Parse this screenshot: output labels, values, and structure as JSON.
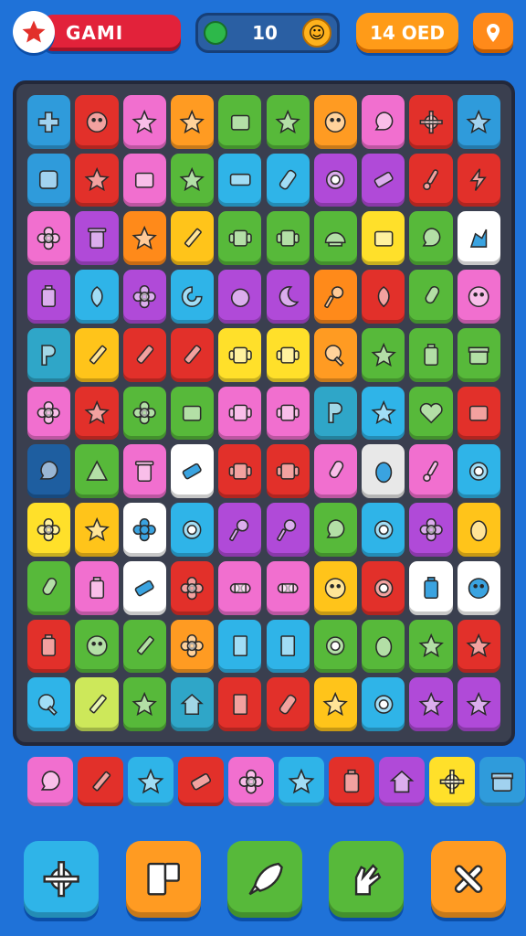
{
  "header": {
    "title": "GAMI",
    "counter_value": "10",
    "score_label": "14 OED"
  },
  "colors": {
    "background": "#1f72d8",
    "board": "#3a3f4f",
    "title_pill": "#e2223a",
    "score_pill": "#ff9b18"
  },
  "grid": {
    "rows": 11,
    "cols": 10,
    "cells": [
      [
        "#2f9bdb:plus-icon",
        "#e2302a:smile-icon",
        "#f16fcf:star-icon",
        "#ff9b22:star-icon",
        "#57b93a:box-icon",
        "#57b93a:star-icon",
        "#ff9b22:smile-icon",
        "#f16fcf:bubble-icon",
        "#e2302a:gear-icon",
        "#2f9bdb:star-icon"
      ],
      [
        "#2f9bdb:dice-icon",
        "#e2302a:star-icon",
        "#f16fcf:box-icon",
        "#57b93a:star-icon",
        "#2fb4e8:letters-icon",
        "#2fb4e8:phone-icon",
        "#b04ad8:ring-icon",
        "#b04ad8:eraser-icon",
        "#e2302a:brush-icon",
        "#e2302a:bolt-icon"
      ],
      [
        "#f16fcf:flower-icon",
        "#b04ad8:trash-icon",
        "#ff8a1a:star-icon",
        "#ffc41a:pencil-icon",
        "#57b93a:mug-icon",
        "#57b93a:mug-icon",
        "#57b93a:shell-icon",
        "#ffe02a:box-icon",
        "#57b93a:bubble-icon",
        "#ffffff:shape-icon"
      ],
      [
        "#b04ad8:battery-icon",
        "#2fb4e8:leaf-icon",
        "#b04ad8:flower-icon",
        "#2fb4e8:swirl-icon",
        "#b04ad8:berry-icon",
        "#b04ad8:moon-icon",
        "#ff8a1a:pin-icon",
        "#e2302a:leaf-icon",
        "#57b93a:candy-icon",
        "#f16fcf:smile-icon"
      ],
      [
        "#2fa6c8:letter-icon",
        "#ffc41a:pencil-icon",
        "#e2302a:marker-icon",
        "#e2302a:marker-icon",
        "#ffe02a:mug-icon",
        "#ffe02a:mug-icon",
        "#ff9b22:search-icon",
        "#57b93a:star-icon",
        "#57b93a:battery-icon",
        "#57b93a:gift-icon"
      ],
      [
        "#f16fcf:flower-icon",
        "#e2302a:star-icon",
        "#57b93a:flower-icon",
        "#57b93a:box-icon",
        "#f16fcf:mug-icon",
        "#f16fcf:mug-icon",
        "#2fa6c8:letter-icon",
        "#2fb4e8:star-icon",
        "#57b93a:heart-icon",
        "#e2302a:box-icon"
      ],
      [
        "#1e5ea0:bubble-icon",
        "#57b93a:triangle-icon",
        "#f16fcf:trash-icon",
        "#ffffff:eraser-icon",
        "#e2302a:mug-icon",
        "#e2302a:mug-icon",
        "#f16fcf:candy-icon",
        "#e8e8e8:egg-icon",
        "#f16fcf:brush-icon",
        "#2fb4e8:ring-icon"
      ],
      [
        "#ffe02a:flower-icon",
        "#ffc41a:star-icon",
        "#ffffff:flower-icon",
        "#2fb4e8:ring-icon",
        "#b04ad8:pin-icon",
        "#b04ad8:pin-icon",
        "#57b93a:bubble-icon",
        "#2fb4e8:ring-icon",
        "#b04ad8:flower-icon",
        "#ffc41a:egg-icon"
      ],
      [
        "#57b93a:candy-icon",
        "#f16fcf:battery-icon",
        "#ffffff:eraser-icon",
        "#e2302a:flower-icon",
        "#f16fcf:tape-icon",
        "#f16fcf:tape-icon",
        "#ffc41a:smile-icon",
        "#e2302a:ring-icon",
        "#ffffff:battery-icon",
        "#ffffff:smile-icon"
      ],
      [
        "#e2302a:battery-icon",
        "#57b93a:smile-icon",
        "#57b93a:pencil-icon",
        "#ff9b22:flower-icon",
        "#2fb4e8:door-icon",
        "#2fb4e8:door-icon",
        "#57b93a:ring-icon",
        "#57b93a:egg-icon",
        "#57b93a:star-icon",
        "#e2302a:star-icon"
      ],
      [
        "#2fb4e8:search-icon",
        "#cde85a:pencil-icon",
        "#57b93a:star-icon",
        "#2fa6c8:house-icon",
        "#e2302a:door-icon",
        "#e2302a:phone-icon",
        "#ffc41a:star-icon",
        "#2fb4e8:ring-icon",
        "#b04ad8:star-icon",
        "#b04ad8:star-icon"
      ]
    ]
  },
  "tray": {
    "slots": [
      "#f16fcf:bubble-icon",
      "#e2302a:pencil-icon",
      "#2fb4e8:star-icon",
      "#e2302a:eraser-icon",
      "#f16fcf:flower-icon",
      "#2fb4e8:star-icon",
      "#e2302a:battery-icon",
      "#b04ad8:house-icon",
      "#ffe02a:gear-icon",
      "#2f9bdb:gift-icon"
    ]
  },
  "tools": [
    {
      "name": "settings-button",
      "color": "#2fb4e8",
      "icon": "gear-icon"
    },
    {
      "name": "shuffle-button",
      "color": "#ff9b22",
      "icon": "blocks-icon"
    },
    {
      "name": "hint-button",
      "color": "#57b93a",
      "icon": "rocket-icon"
    },
    {
      "name": "undo-button",
      "color": "#57b93a",
      "icon": "glove-icon"
    },
    {
      "name": "tools-button",
      "color": "#ff9b22",
      "icon": "tools-icon"
    }
  ]
}
